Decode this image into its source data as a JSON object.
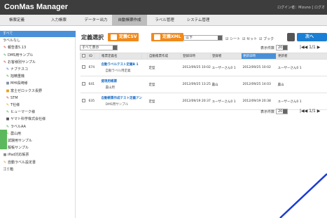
{
  "app": {
    "title": "ConMas Manager",
    "user_info": "ログイン者：Mizuno [ ログオ"
  },
  "menu": [
    "帳票定義",
    "入力帳票",
    "データー出力",
    "自動帳票作成",
    "ラベル管理",
    "システム管理"
  ],
  "menu_active_index": 3,
  "sidebar": {
    "items": [
      {
        "label": "すべて",
        "icon": "",
        "color": "",
        "indent": 0
      },
      {
        "label": "ラベルなし",
        "icon": "",
        "color": "",
        "indent": 0
      },
      {
        "label": "報告書5.13",
        "icon": "pencil-icon",
        "color": "#c0392b",
        "indent": 0
      },
      {
        "label": "DMS用サンプル",
        "icon": "pencil-icon",
        "color": "#3fa34d",
        "indent": 0
      },
      {
        "label": "お客様別サンプル",
        "icon": "pencil-icon",
        "color": "#c0392b",
        "indent": 0
      },
      {
        "label": "ナブテスコ",
        "icon": "pencil-icon",
        "color": "#2b6cd4",
        "indent": 1
      },
      {
        "label": "旭精重機",
        "icon": "pencil-icon",
        "color": "#3fa34d",
        "indent": 1
      },
      {
        "label": "MHI長崎様",
        "icon": "square-icon",
        "color": "#7f8fa6",
        "indent": 1
      },
      {
        "label": "富士ゼロックス長野",
        "icon": "square-icon",
        "color": "#e0a020",
        "indent": 1
      },
      {
        "label": "STM",
        "icon": "pencil-icon",
        "color": "#c0392b",
        "indent": 1
      },
      {
        "label": "T社様",
        "icon": "pencil-icon",
        "color": "#e0a020",
        "indent": 1
      },
      {
        "label": "ヒューマーク様",
        "icon": "pencil-icon",
        "color": "#3fa34d",
        "indent": 1
      },
      {
        "label": "ヤマト科学株式会社様",
        "icon": "square-icon",
        "color": "#555555",
        "indent": 1
      },
      {
        "label": "ラベルAA",
        "icon": "pencil-icon",
        "color": "#3fa34d",
        "indent": 1
      },
      {
        "label": "農山用",
        "icon": "pencil-icon",
        "color": "#e0a020",
        "indent": 1
      },
      {
        "label": "試験用サンプル",
        "icon": "pencil-icon",
        "color": "#e0a020",
        "indent": 0
      },
      {
        "label": "擬帳サンプル",
        "icon": "pencil-icon",
        "color": "#3fa34d",
        "indent": 0
      },
      {
        "label": "iPad対応帳票",
        "icon": "square-icon",
        "color": "#888888",
        "indent": 0
      },
      {
        "label": "自動ラベル設定書",
        "icon": "pencil-icon",
        "color": "#e0a020",
        "indent": 0
      },
      {
        "label": "ゴミ箱",
        "icon": "",
        "color": "",
        "indent": 0
      }
    ]
  },
  "toolbar": {
    "label": "定義選択",
    "csv_button": "定義CSV",
    "xml_button": "定義XML",
    "xml_select_value": "以下",
    "chk_sheet": "☑ シート",
    "chk_set": "☑ セット",
    "chk_book": "☑ ブック",
    "next_button": "次へ"
  },
  "filter": {
    "value": "すべて表示"
  },
  "counts": {
    "label": "表示件数",
    "value": "20",
    "pager_text": "1/1"
  },
  "table": {
    "headers": [
      "",
      "ID",
      "",
      "帳票定義名",
      "",
      "自動帳票作成",
      "登録日時",
      "登録者",
      "更新日時",
      "更新者"
    ],
    "sorted_column": 8,
    "rows": [
      {
        "id": "674",
        "title": "自動ラベルテスト定義B 1",
        "sub": "自動ラベル用定義",
        "type": "定型",
        "reg_date": "2012/09/25 10:02",
        "reg_user": "ユーザーさん0 1",
        "upd_date": "2012/09/25 10:02",
        "upd_user": "ユーザーさん0 1"
      },
      {
        "id": "641",
        "title": "提現用帳票",
        "sub": "農山用",
        "type": "定型",
        "reg_date": "2012/09/25 13:25",
        "reg_user": "農山",
        "upd_date": "2012/09/25 14:03",
        "upd_user": "農山"
      },
      {
        "id": "635",
        "title": "自動帳票作成テスト定義アンケート",
        "sub": "DMS用サンプル",
        "type": "定型",
        "reg_date": "2012/09/19 20:37",
        "reg_user": "ユーザーさん0 1",
        "upd_date": "2012/09/19 20:38",
        "upd_user": "ユーザーさん0 1"
      }
    ]
  },
  "colors": {
    "accent": "#4a90d9",
    "orange": "#f08a1c",
    "header_bg": "#3d3d3d",
    "next_blue": "#1a7fd4"
  }
}
